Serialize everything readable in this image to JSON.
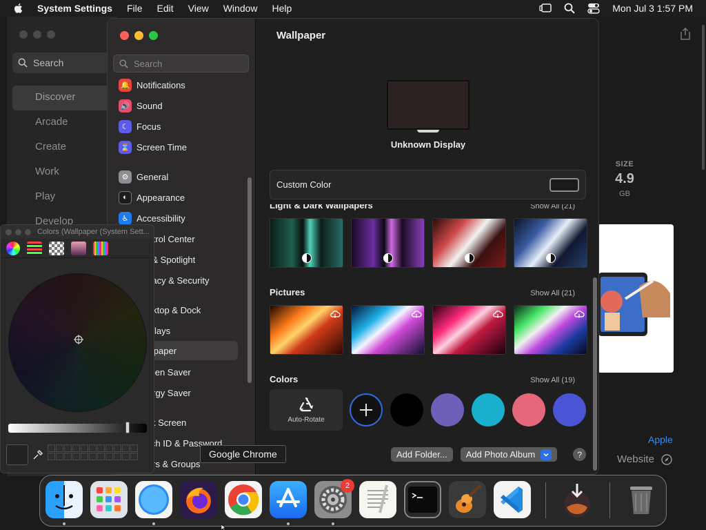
{
  "menubar": {
    "app_name": "System Settings",
    "items": [
      "File",
      "Edit",
      "View",
      "Window",
      "Help"
    ],
    "clock": "Mon Jul 3  1:57 PM"
  },
  "app_store": {
    "search_label": "Search",
    "nav": [
      "Discover",
      "Arcade",
      "Create",
      "Work",
      "Play",
      "Develop"
    ],
    "size_label": "SIZE",
    "size_value": "4.9",
    "size_unit": "GB",
    "developer_link": "Apple",
    "website_label": "Website"
  },
  "settings": {
    "search_placeholder": "Search",
    "sidebar_items": [
      {
        "label": "Notifications",
        "icon": "bell-icon",
        "color": "#e8453c"
      },
      {
        "label": "Sound",
        "icon": "speaker-icon",
        "color": "#ea4c6b"
      },
      {
        "label": "Focus",
        "icon": "moon-icon",
        "color": "#5e5ce6"
      },
      {
        "label": "Screen Time",
        "icon": "hourglass-icon",
        "color": "#5e5ce6"
      },
      {
        "label": "General",
        "icon": "gear-icon",
        "color": "#8e8e93"
      },
      {
        "label": "Appearance",
        "icon": "appearance-icon",
        "color": "#1c1c1e"
      },
      {
        "label": "Accessibility",
        "icon": "accessibility-icon",
        "color": "#1e7cf0"
      },
      {
        "label": "Control Center",
        "icon": "control-center-icon",
        "color": "#8e8e93"
      },
      {
        "label": "Siri & Spotlight",
        "icon": "siri-icon",
        "color": "#c04df0"
      },
      {
        "label": "Privacy & Security",
        "icon": "hand-icon",
        "color": "#1e7cf0"
      },
      {
        "label": "Desktop & Dock",
        "icon": "dock-icon",
        "color": "#1c1c1e"
      },
      {
        "label": "Displays",
        "icon": "display-icon",
        "color": "#1e7cf0"
      },
      {
        "label": "Wallpaper",
        "icon": "wallpaper-icon",
        "color": "#32ade6"
      },
      {
        "label": "Screen Saver",
        "icon": "screen-saver-icon",
        "color": "#32ade6"
      },
      {
        "label": "Energy Saver",
        "icon": "battery-icon",
        "color": "#34c759"
      },
      {
        "label": "Lock Screen",
        "icon": "lock-icon",
        "color": "#1c1c1e"
      },
      {
        "label": "Touch ID & Password",
        "icon": "fingerprint-icon",
        "color": "#ffffff"
      },
      {
        "label": "Users & Groups",
        "icon": "users-icon",
        "color": "#1e7cf0"
      }
    ],
    "selected_item": "Wallpaper",
    "main": {
      "title": "Wallpaper",
      "display_name": "Unknown Display",
      "custom_color_label": "Custom Color",
      "sections": {
        "dynamic": {
          "title": "Light & Dark Wallpapers",
          "show_all": "Show All (21)"
        },
        "pictures": {
          "title": "Pictures",
          "show_all": "Show All (21)"
        },
        "colors": {
          "title": "Colors",
          "show_all": "Show All (19)"
        }
      },
      "auto_rotate_label": "Auto-Rotate",
      "color_swatches": [
        "#000000",
        "#6e5fb9",
        "#1aafcd",
        "#e5687a",
        "#4a55d6"
      ],
      "add_folder_button": "Add Folder...",
      "add_album_button": "Add Photo Album",
      "help_button": "?"
    }
  },
  "colors_panel": {
    "title": "Colors (Wallpaper (System Sett..."
  },
  "tooltip": "Google Chrome",
  "dock": {
    "apps": [
      "Finder",
      "Launchpad",
      "Safari",
      "Firefox",
      "Google Chrome",
      "App Store",
      "System Settings",
      "TextEdit",
      "Terminal",
      "GarageBand",
      "Visual Studio Code",
      "Downloads",
      "Trash"
    ],
    "settings_badge": "2"
  }
}
